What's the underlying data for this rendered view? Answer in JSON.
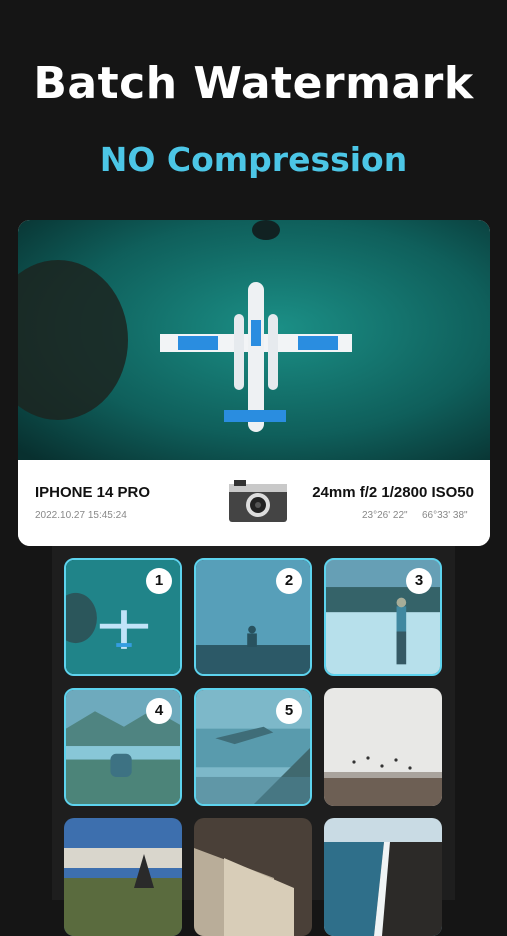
{
  "header": {
    "title": "Batch Watermark",
    "subtitle": "NO Compression"
  },
  "preview": {
    "device": "IPHONE 14 PRO",
    "datetime": "2022.10.27 15:45:24",
    "exif": "24mm f/2 1/2800 ISO50",
    "latitude": "23°26' 22\"",
    "longitude": "66°33' 38\"",
    "camera_icon": "camera-icon"
  },
  "grid": {
    "tiles": [
      {
        "badge": "1",
        "selected": true,
        "image": "seaplane-aerial"
      },
      {
        "badge": "2",
        "selected": true,
        "image": "person-silhouette-sky"
      },
      {
        "badge": "3",
        "selected": true,
        "image": "person-snowy-beach"
      },
      {
        "badge": "4",
        "selected": true,
        "image": "person-sitting-lake"
      },
      {
        "badge": "5",
        "selected": true,
        "image": "rocky-coast-waves"
      },
      {
        "badge": "",
        "selected": false,
        "image": "birds-over-beach"
      },
      {
        "badge": "",
        "selected": false,
        "image": "rock-pillars-coast"
      },
      {
        "badge": "",
        "selected": false,
        "image": "book-pages"
      },
      {
        "badge": "",
        "selected": false,
        "image": "black-sand-shoreline"
      }
    ]
  },
  "colors": {
    "accent": "#4cc6e6",
    "selection_border": "#5dd3ee",
    "background": "#151515"
  }
}
